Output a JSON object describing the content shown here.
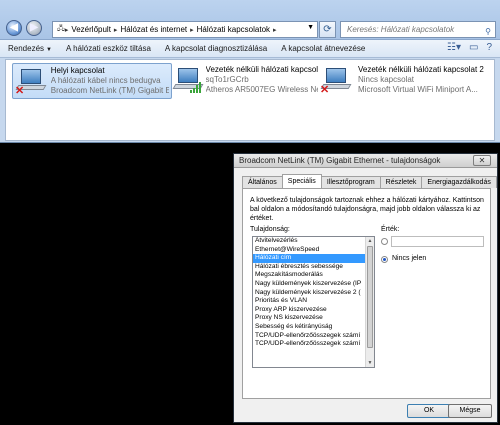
{
  "explorer": {
    "breadcrumb": [
      "Vezérlőpult",
      "Hálózat és internet",
      "Hálózati kapcsolatok"
    ],
    "search_placeholder": "Keresés: Hálózati kapcsolatok",
    "toolbar": [
      "Rendezés",
      "A hálózati eszköz tiltása",
      "A kapcsolat diagnosztizálása",
      "A kapcsolat átnevezése"
    ],
    "connections": [
      {
        "name": "Helyi kapcsolat",
        "status": "A hálózati kábel nincs bedugva",
        "device": "Broadcom NetLink (TM) Gigabit E...",
        "icon": "wired-network-icon",
        "selected": true,
        "disconnected": true
      },
      {
        "name": "Vezeték nélküli hálózati kapcsolat",
        "status": "sqTo1rGCrb",
        "device": "Atheros AR5007EG Wireless Netw...",
        "icon": "wireless-network-icon"
      },
      {
        "name": "Vezeték nélküli hálózati kapcsolat 2",
        "status": "Nincs kapcsolat",
        "device": "Microsoft Virtual WiFi Miniport A...",
        "icon": "wireless-network-icon",
        "disconnected": true
      }
    ]
  },
  "dialog": {
    "title": "Broadcom NetLink (TM) Gigabit Ethernet - tulajdonságok",
    "tabs": [
      "Általános",
      "Speciális",
      "Illesztőprogram",
      "Részletek",
      "Energiagazdálkodás"
    ],
    "active_tab": "Speciális",
    "description": "A következő tulajdonságok tartoznak ehhez a hálózati kártyához. Kattintson bal oldalon a módosítandó tulajdonságra, majd jobb oldalon válassza ki az értéket.",
    "property_label": "Tulajdonság:",
    "value_label": "Érték:",
    "properties": [
      "Átvitelvezérlés",
      "Ethernet@WireSpeed",
      "Hálózati cím",
      "Hálózati ébresztés sebessége",
      "Megszakításmoderálás",
      "Nagy küldemények kiszervezése (IP",
      "Nagy küldemények kiszervezése 2 (",
      "Prioritás és VLAN",
      "Proxy ARP kiszervezése",
      "Proxy NS kiszervezése",
      "Sebesség és kétirányúság",
      "TCP/UDP-ellenőrzőösszegek számí",
      "TCP/UDP-ellenőrzőösszegek számí"
    ],
    "selected_property": "Hálózati cím",
    "value_input": "",
    "radio_option_label": "Nincs jelen",
    "radio_selected": "Nincs jelen",
    "ok_label": "OK",
    "cancel_label": "Mégse"
  }
}
